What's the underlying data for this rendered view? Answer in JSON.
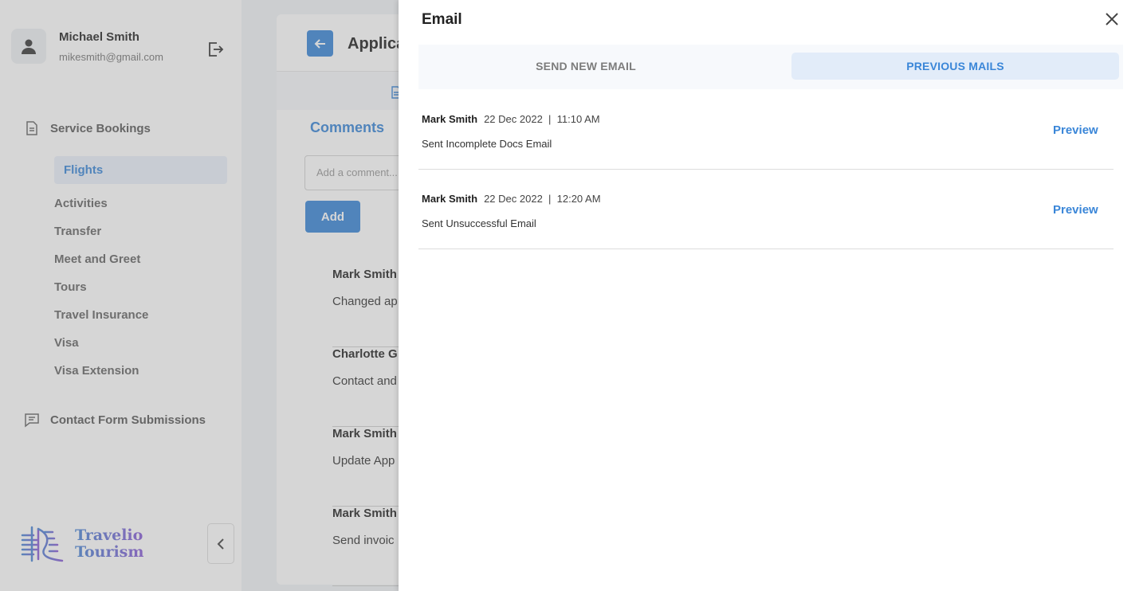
{
  "user": {
    "name": "Michael Smith",
    "email": "mikesmith@gmail.com"
  },
  "sidebar": {
    "service_bookings_label": "Service Bookings",
    "items": [
      {
        "label": "Flights",
        "active": true
      },
      {
        "label": "Activities"
      },
      {
        "label": "Transfer"
      },
      {
        "label": "Meet and Greet"
      },
      {
        "label": "Tours"
      },
      {
        "label": "Travel Insurance"
      },
      {
        "label": "Visa"
      },
      {
        "label": "Visa Extension"
      }
    ],
    "contact_label": "Contact Form Submissions",
    "logo_line1": "Travelio",
    "logo_line2": "Tourism"
  },
  "main": {
    "title": "Applica",
    "comments_title": "Comments",
    "comment_placeholder": "Add a comment...",
    "add_label": "Add",
    "comments": [
      {
        "author": "Mark Smith",
        "text": "Changed ap"
      },
      {
        "author": "Charlotte G",
        "text": "Contact and"
      },
      {
        "author": "Mark Smith",
        "text": "Update App"
      },
      {
        "author": "Mark Smith",
        "text": "Send invoic"
      }
    ]
  },
  "email_drawer": {
    "title": "Email",
    "tabs": {
      "send_new": "SEND NEW EMAIL",
      "previous": "PREVIOUS MAILS"
    },
    "mails": [
      {
        "sender": "Mark Smith",
        "date": "22 Dec 2022  |  11:10 AM",
        "subject": "Sent Incomplete Docs Email",
        "action": "Preview"
      },
      {
        "sender": "Mark Smith",
        "date": "22 Dec 2022  |  12:20 AM",
        "subject": "Sent Unsuccessful Email",
        "action": "Preview"
      }
    ]
  },
  "colors": {
    "accent": "#3a86d8",
    "accent_soft": "#e2ecf9"
  }
}
